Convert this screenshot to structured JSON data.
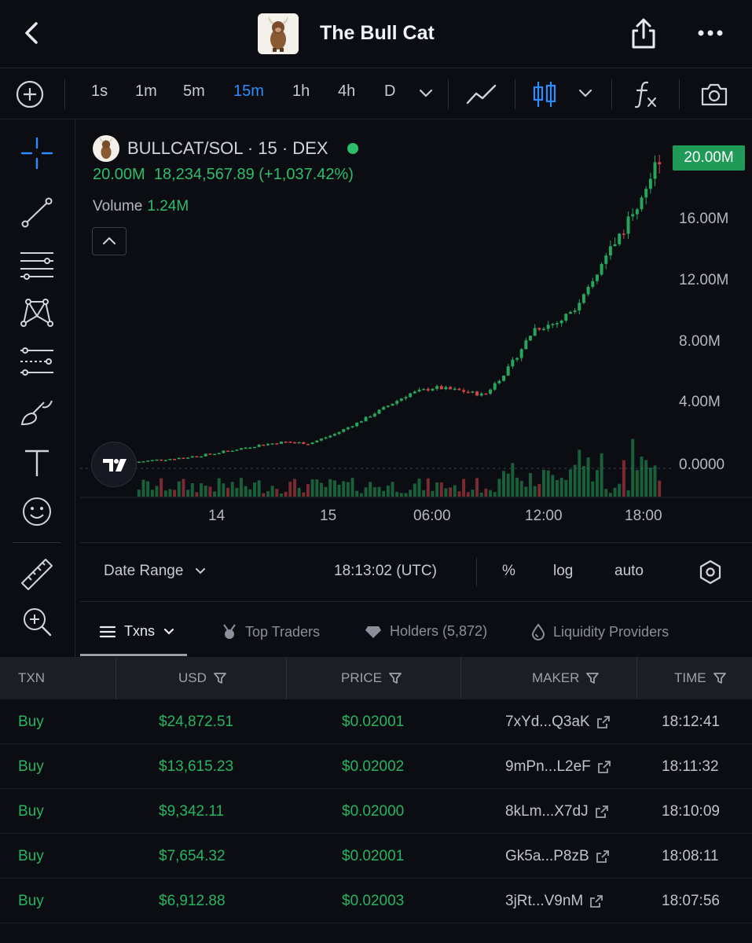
{
  "header": {
    "title": "The Bull Cat"
  },
  "toolbar": {
    "intervals": [
      "1s",
      "1m",
      "5m",
      "15m",
      "1h",
      "4h",
      "D"
    ],
    "active_interval": "15m",
    "fx_label": "f"
  },
  "chart": {
    "pair": "BULLCAT/SOL · 15 · DEX",
    "legend_price": "20.00M",
    "legend_change": "18,234,567.89 (+1,037.42%)",
    "volume_label": "Volume",
    "volume_value": "1.24M",
    "price_tag": "20.00M",
    "y_ticks": [
      "16.00M",
      "12.00M",
      "8.00M",
      "4.00M",
      "0.0000"
    ],
    "x_ticks": [
      "14",
      "15",
      "06:00",
      "12:00",
      "18:00"
    ],
    "colors": {
      "up": "#26a65b",
      "down": "#d8434a",
      "tag": "#1f9b57",
      "accent": "#2e8cff"
    }
  },
  "chart_data": {
    "type": "candlestick",
    "title": "",
    "xlabel": "",
    "ylabel": "",
    "ylim": [
      0,
      20000000
    ],
    "x": [
      "14",
      "15",
      "06:00",
      "12:00",
      "18:00"
    ],
    "series": [
      {
        "values": [
          400000,
          550000,
          700000,
          900000,
          1200000,
          1500000,
          1700000,
          1600000,
          2200000,
          3000000,
          3900000,
          4800000,
          5200000,
          5000000,
          4700000,
          6500000,
          9000000,
          9400000,
          11000000,
          14000000,
          16500000,
          20000000
        ]
      }
    ]
  },
  "chart_footer": {
    "date_range": "Date Range",
    "time": "18:13:02 (UTC)",
    "percent": "%",
    "log": "log",
    "auto": "auto"
  },
  "tabs": {
    "txns": "Txns",
    "top_traders": "Top Traders",
    "holders": "Holders (5,872)",
    "liquidity": "Liquidity Providers"
  },
  "table": {
    "headers": [
      "TXN",
      "USD",
      "PRICE",
      "MAKER",
      "TIME"
    ],
    "rows": [
      {
        "txn": "Buy",
        "usd": "$24,872.51",
        "price": "$0.02001",
        "maker": "7xYd...Q3aK",
        "time": "18:12:41"
      },
      {
        "txn": "Buy",
        "usd": "$13,615.23",
        "price": "$0.02002",
        "maker": "9mPn...L2eF",
        "time": "18:11:32"
      },
      {
        "txn": "Buy",
        "usd": "$9,342.11",
        "price": "$0.02000",
        "maker": "8kLm...X7dJ",
        "time": "18:10:09"
      },
      {
        "txn": "Buy",
        "usd": "$7,654.32",
        "price": "$0.02001",
        "maker": "Gk5a...P8zB",
        "time": "18:08:11"
      },
      {
        "txn": "Buy",
        "usd": "$6,912.88",
        "price": "$0.02003",
        "maker": "3jRt...V9nM",
        "time": "18:07:56"
      }
    ]
  }
}
